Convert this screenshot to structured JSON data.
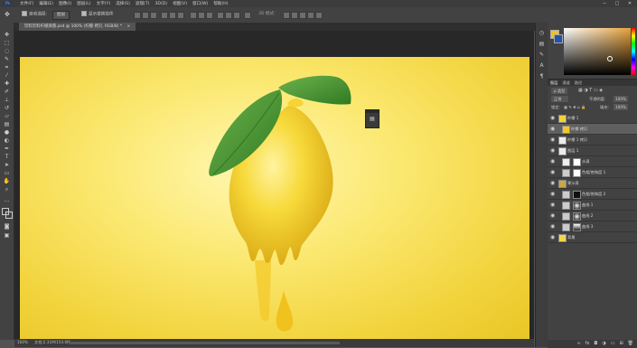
{
  "app": {
    "icon": "Ps"
  },
  "menubar": {
    "items": [
      "文件(F)",
      "编辑(E)",
      "图像(I)",
      "图层(L)",
      "文字(Y)",
      "选择(S)",
      "滤镜(T)",
      "3D(D)",
      "视图(V)",
      "窗口(W)",
      "帮助(H)"
    ]
  },
  "window_controls": {
    "minimize": "─",
    "maximize": "□",
    "close": "✕"
  },
  "options": {
    "auto_select_label": "自动选择:",
    "auto_select_value": "图层",
    "transform_label": "显示变换控件",
    "mode_label": "3D 模式:"
  },
  "document": {
    "tab_title": "饮料饮料柠檬滴落.psd @ 100% (柠檬 拷贝, RGB/8) *",
    "tab_close": "×"
  },
  "status": {
    "zoom": "100%",
    "doc_info": "文档:2.31M/154.6M"
  },
  "layers_panel": {
    "tabs": [
      "图层",
      "通道",
      "路径"
    ],
    "kind_label": "ρ 类型",
    "blend_mode": "正常",
    "opacity_label": "不透明度:",
    "opacity_value": "100%",
    "lock_label": "锁定:",
    "fill_label": "填充:",
    "fill_value": "100%",
    "layers": [
      {
        "name": "柠檬 1"
      },
      {
        "name": "柠檬 拷贝"
      },
      {
        "name": "柠檬 1 拷贝"
      },
      {
        "name": "图层 1"
      },
      {
        "name": "水滴"
      },
      {
        "name": "色相/饱和度 1"
      },
      {
        "name": "果汁滴"
      },
      {
        "name": "色相/饱和度 2"
      },
      {
        "name": "曲线 1"
      },
      {
        "name": "曲线 2"
      },
      {
        "name": "曲线 3"
      },
      {
        "name": "背景"
      }
    ]
  },
  "colors": {
    "foreground": "#f0c21e",
    "background": "#2453a8",
    "artboard": "#f6dc52",
    "lemon": "#f4cc22",
    "leaf": "#3f8f2c"
  }
}
